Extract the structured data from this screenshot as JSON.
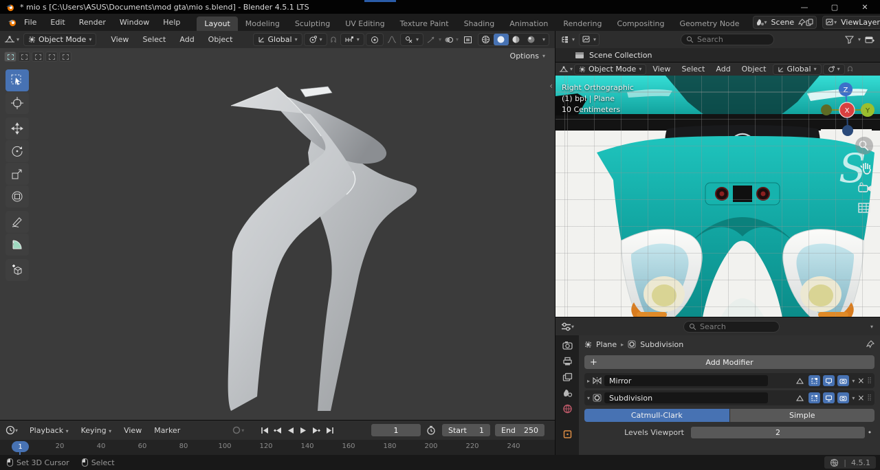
{
  "window": {
    "title": "* mio s [C:\\Users\\ASUS\\Documents\\mod gta\\mio s.blend] - Blender 4.5.1 LTS"
  },
  "topbar": {
    "menus": [
      "File",
      "Edit",
      "Render",
      "Window",
      "Help"
    ],
    "workspaces": [
      "Layout",
      "Modeling",
      "Sculpting",
      "UV Editing",
      "Texture Paint",
      "Shading",
      "Animation",
      "Rendering",
      "Compositing",
      "Geometry Node"
    ],
    "scene_name": "Scene",
    "viewlayer_name": "ViewLayer"
  },
  "left_viewport": {
    "mode": "Object Mode",
    "menus": [
      "View",
      "Select",
      "Add",
      "Object"
    ],
    "orientation": "Global",
    "options_label": "Options"
  },
  "right_viewport": {
    "mode": "Object Mode",
    "menus": [
      "View",
      "Select",
      "Add",
      "Object"
    ],
    "orientation": "Global",
    "overlay": {
      "line1": "Right Orthographic",
      "line2": "(1) bpl | Plane",
      "line3": "10 Centimeters"
    },
    "gizmo": {
      "x": "X",
      "y": "Y",
      "z": "Z"
    }
  },
  "outliner": {
    "search_placeholder": "Search",
    "scene_collection": "Scene Collection"
  },
  "properties": {
    "search_placeholder": "Search",
    "breadcrumb": {
      "object": "Plane",
      "active": "Subdivision"
    },
    "add_modifier_label": "Add Modifier",
    "modifiers": [
      {
        "name": "Mirror"
      },
      {
        "name": "Subdivision"
      }
    ],
    "subdivision": {
      "catmull": "Catmull-Clark",
      "simple": "Simple",
      "levels_label": "Levels Viewport",
      "levels_value": "2"
    }
  },
  "timeline": {
    "menus": [
      "Playback",
      "Keying",
      "View",
      "Marker"
    ],
    "current_frame": "1",
    "start_label": "Start",
    "start_value": "1",
    "end_label": "End",
    "end_value": "250",
    "ticks": [
      "20",
      "40",
      "60",
      "80",
      "100",
      "120",
      "140",
      "160",
      "180",
      "200",
      "220",
      "240"
    ],
    "playhead": "1"
  },
  "statusbar": {
    "hint1": "Set 3D Cursor",
    "hint2": "Select",
    "version": "4.5.1"
  },
  "colors": {
    "accent": "#4772b3",
    "teal": "#14b8b4",
    "viewport_bg": "#3b3b3b"
  }
}
